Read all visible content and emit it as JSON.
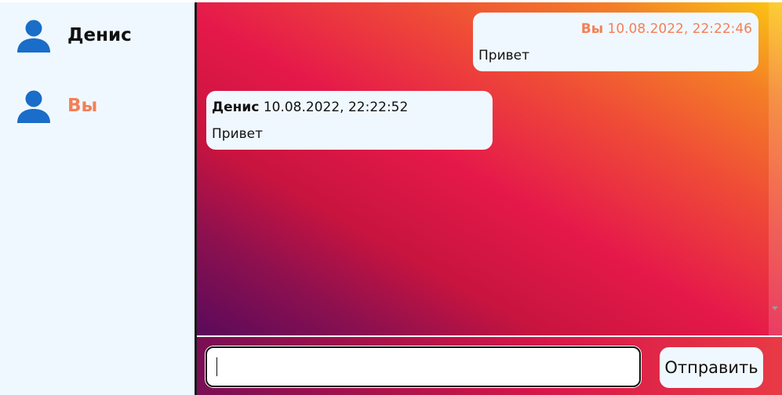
{
  "colors": {
    "sidebar_bg": "#f0f8ff",
    "user_icon": "#1a6dc8",
    "current_user_accent": "#f47f55",
    "bubble_bg": "#f0f8ff",
    "text_dark": "#111111"
  },
  "sidebar": {
    "users": [
      {
        "name": "Денис",
        "icon": "person-icon",
        "is_current": false
      },
      {
        "name": "Вы",
        "icon": "person-icon",
        "is_current": true
      }
    ]
  },
  "chat": {
    "messages": [
      {
        "author": "Вы",
        "timestamp": "10.08.2022, 22:22:46",
        "text": "Привет",
        "own": true
      },
      {
        "author": "Денис",
        "timestamp": "10.08.2022, 22:22:52",
        "text": "Привет",
        "own": false
      }
    ]
  },
  "composer": {
    "input_value": "",
    "send_label": "Отправить"
  }
}
